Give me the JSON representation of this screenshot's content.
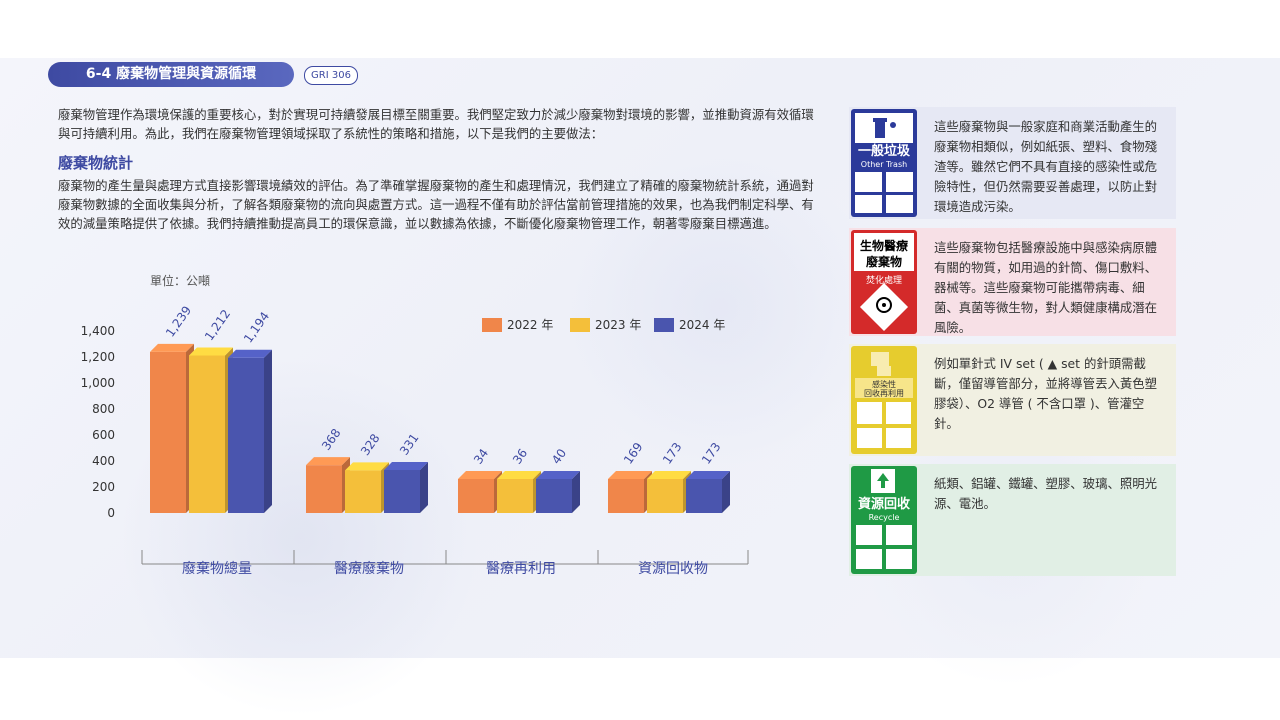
{
  "header": {
    "section_title": "6-4 廢棄物管理與資源循環",
    "gri_badge": "GRI 306"
  },
  "intro": {
    "text": "廢棄物管理作為環境保護的重要核心，對於實現可持續發展目標至關重要。我們堅定致力於減少廢棄物對環境的影響，並推動資源有效循環與可持續利用。為此，我們在廢棄物管理領域採取了系統性的策略和措施，以下是我們的主要做法："
  },
  "stats": {
    "heading": "廢棄物統計",
    "text": "廢棄物的產生量與處理方式直接影響環境績效的評估。為了準確掌握廢棄物的產生和處理情況，我們建立了精確的廢棄物統計系統，通過對廢棄物數據的全面收集與分析，了解各類廢棄物的流向與處置方式。這一過程不僅有助於評估當前管理措施的效果，也為我們制定科學、有效的減量策略提供了依據。我們持續推動提高員工的環保意識，並以數據為依據，不斷優化廢棄物管理工作，朝著零廢棄目標邁進。"
  },
  "chart_data": {
    "type": "bar",
    "unit": "單位：公噸",
    "categories": [
      "廢棄物總量",
      "醫療廢棄物",
      "醫療再利用",
      "資源回收物"
    ],
    "series": [
      {
        "name": "2022 年",
        "values": [
          1239,
          368,
          34,
          169
        ],
        "labels": [
          "1,239",
          "368",
          "34",
          "169"
        ],
        "color": "#f0864a"
      },
      {
        "name": "2023 年",
        "values": [
          1212,
          328,
          36,
          173
        ],
        "labels": [
          "1,212",
          "328",
          "36",
          "173"
        ],
        "color": "#f4bf3a"
      },
      {
        "name": "2024 年",
        "values": [
          1194,
          331,
          40,
          173
        ],
        "labels": [
          "1,194",
          "331",
          "40",
          "173"
        ],
        "color": "#4a55ae"
      }
    ],
    "yticks": [
      0,
      200,
      400,
      600,
      800,
      1000,
      1200,
      1400
    ],
    "ytick_labels": [
      "0",
      "200",
      "400",
      "600",
      "800",
      "1,000",
      "1,200",
      "1,400"
    ],
    "ylim": [
      0,
      1400
    ],
    "legend_position": "top-right",
    "grid": false
  },
  "cards": {
    "general": {
      "title": "一般垃圾",
      "subtitle": "Other Trash",
      "text": "這些廢棄物與一般家庭和商業活動產生的廢棄物相類似，例如紙張、塑料、食物殘渣等。雖然它們不具有直接的感染性或危險特性，但仍然需要妥善處理，以防止對環境造成污染。",
      "color": "#2b3a9a"
    },
    "medical": {
      "title": "生物醫療廢棄物",
      "subtitle": "焚化處理",
      "text": "這些廢棄物包括醫療設施中與感染病原體有關的物質，如用過的針筒、傷口敷料、器械等。這些廢棄物可能攜帶病毒、細菌、真菌等微生物，對人類健康構成潛在風險。",
      "color": "#d42a2a"
    },
    "infectious": {
      "title": "感染性回收再利用",
      "text": "例如單針式 IV set ( ▲ set 的針頭需截斷，僅留導管部分，並將導管丟入黃色塑膠袋）、O2 導管 ( 不含口罩 )、管灌空針。",
      "color": "#e6cc2e"
    },
    "recycle": {
      "title": "資源回收",
      "subtitle": "Recycle",
      "text": "紙類、鋁罐、鐵罐、塑膠、玻璃、照明光源、電池。",
      "color": "#1f9a45"
    }
  }
}
